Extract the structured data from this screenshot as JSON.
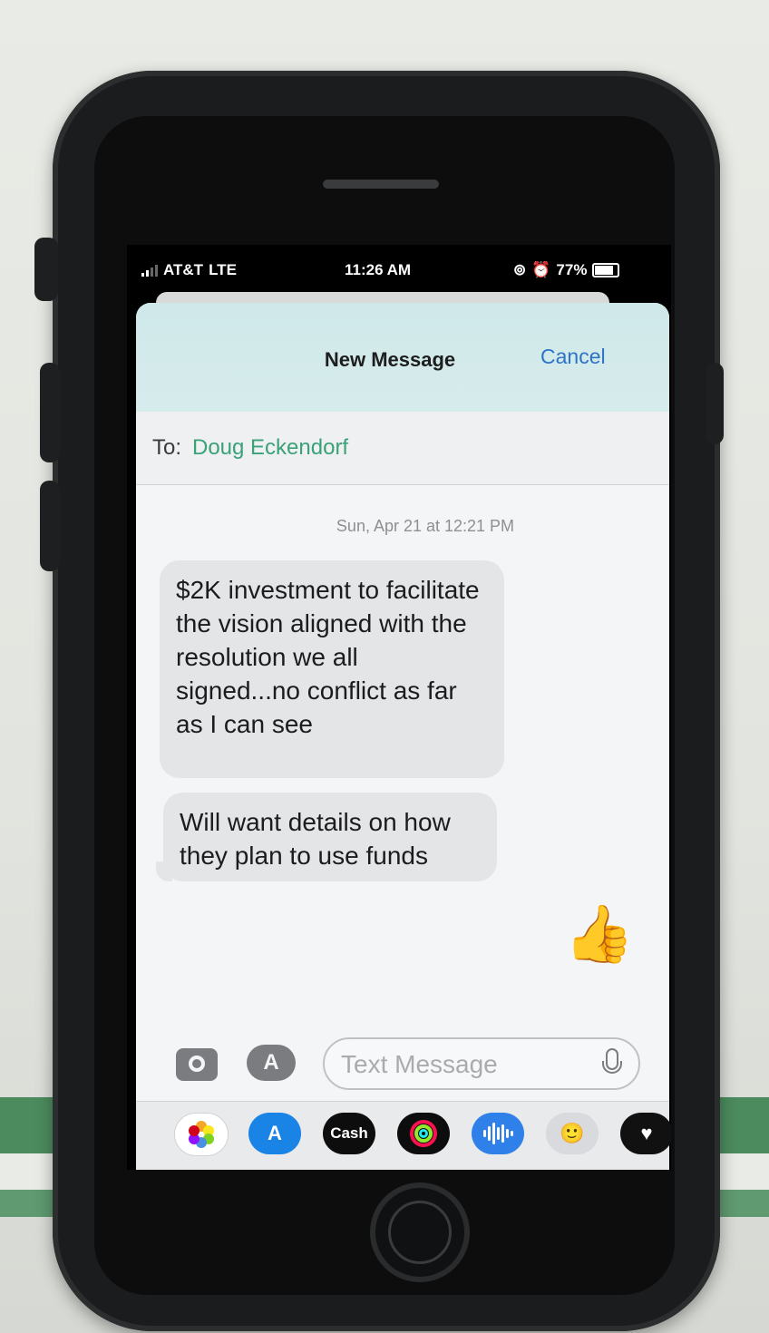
{
  "status_bar": {
    "carrier": "AT&T",
    "network": "LTE",
    "time": "11:26 AM",
    "battery": "77%",
    "battery_level": 0.77,
    "icons": [
      "lock-rotation-icon",
      "alarm-icon",
      "battery-icon"
    ]
  },
  "compose": {
    "title": "New Message",
    "cancel_label": "Cancel",
    "to_label": "To:",
    "recipient": "Doug Eckendorf"
  },
  "conversation": {
    "timestamp": "Sun, Apr 21 at 12:21 PM",
    "messages": [
      {
        "sender": "received",
        "text": "$2K investment to facilitate the vision aligned with the resolution we all signed...no conflict as far as I can see"
      },
      {
        "sender": "received",
        "text": "Will want details on how they plan to use funds"
      },
      {
        "sender": "sent",
        "text": "👍"
      }
    ]
  },
  "input_bar": {
    "placeholder": "Text Message",
    "icons": [
      "camera-icon",
      "app-store-icon",
      "microphone-icon"
    ]
  },
  "app_drawer": {
    "apps": [
      {
        "name": "Photos",
        "icon": "photos-icon"
      },
      {
        "name": "App Store",
        "icon": "app-store-icon"
      },
      {
        "name": "Cash",
        "label": "Cash",
        "icon": "apple-cash-icon"
      },
      {
        "name": "Activity",
        "icon": "activity-rings-icon"
      },
      {
        "name": "Audio",
        "icon": "audio-wave-icon"
      },
      {
        "name": "Memoji",
        "icon": "memoji-icon"
      },
      {
        "name": "Digital Touch",
        "icon": "heart-icon"
      }
    ]
  },
  "colors": {
    "accent_blue": "#2f73c9",
    "recipient_green": "#3aa178",
    "bubble_gray": "#e4e5e7",
    "header_tint": "#cfe8e9"
  }
}
